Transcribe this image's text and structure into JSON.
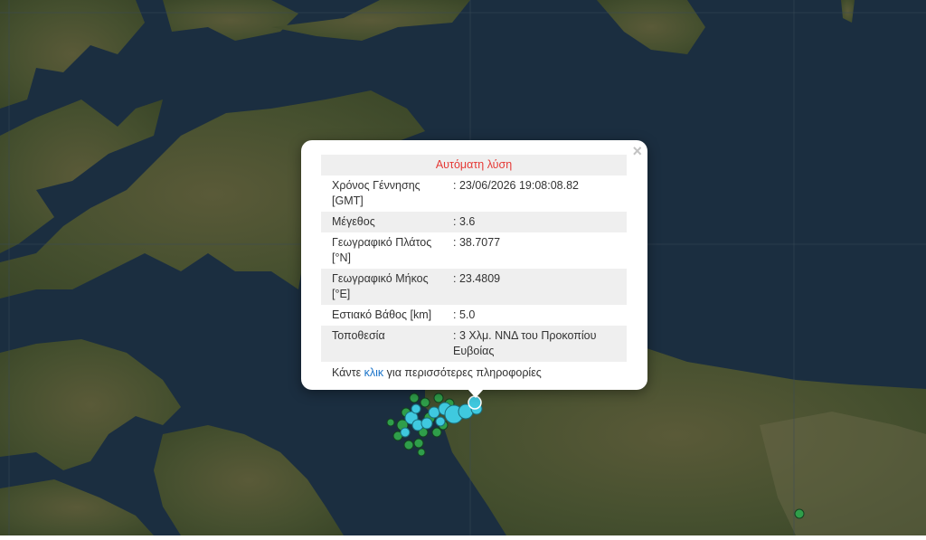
{
  "popup": {
    "header": "Αυτόματη λύση",
    "close_symbol": "×",
    "rows": [
      {
        "label": "Χρόνος Γέννησης [GMT]",
        "value": ": 23/06/2026 19:08:08.82"
      },
      {
        "label": "Μέγεθος",
        "value": ": 3.6"
      },
      {
        "label": "Γεωγραφικό Πλάτος [°N]",
        "value": ": 38.7077"
      },
      {
        "label": "Γεωγραφικό Μήκος [°E]",
        "value": ": 23.4809"
      },
      {
        "label": "Εστιακό Βάθος [km]",
        "value": ": 5.0"
      },
      {
        "label": "Τοποθεσία",
        "value": ": 3 Χλμ. ΝΝΔ του Προκοπίου Ευβοίας"
      }
    ],
    "more_prefix": "Κάντε ",
    "more_link": "κλικ",
    "more_suffix": " για περισσότερες πληροφορίες"
  },
  "map": {
    "sea_color": "#1b2e40",
    "land_color": "#4a5232",
    "marker_colors": {
      "recent": "#3fc9df",
      "older": "#2f9e4a"
    }
  }
}
